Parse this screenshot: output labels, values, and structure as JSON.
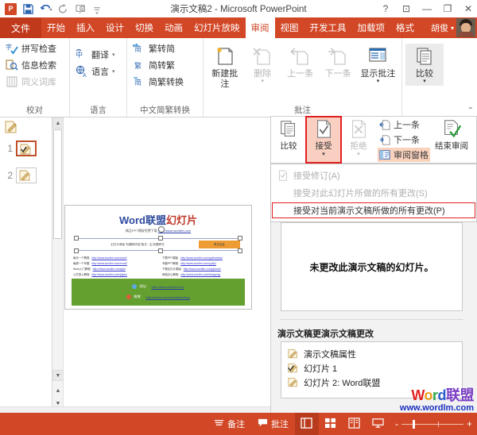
{
  "titlebar": {
    "app_logo": "powerpoint-logo",
    "title": "演示文稿2 - Microsoft PowerPoint",
    "quick_access": [
      {
        "name": "save-icon",
        "label": "保存"
      },
      {
        "name": "undo-icon",
        "label": "撤消"
      },
      {
        "name": "redo-icon",
        "label": "重复"
      },
      {
        "name": "from-beginning-icon",
        "label": "从头开始"
      },
      {
        "name": "customize-qat-icon",
        "label": "自定义快速访问工具栏"
      }
    ],
    "window_buttons": [
      {
        "name": "help-button",
        "glyph": "?"
      },
      {
        "name": "ribbon-display-options-button",
        "glyph": "⊡"
      },
      {
        "name": "minimize-button",
        "glyph": "—"
      },
      {
        "name": "maximize-button",
        "glyph": "❐"
      },
      {
        "name": "close-button",
        "glyph": "✕"
      }
    ]
  },
  "tabs": {
    "file_label": "文件",
    "items": [
      {
        "label": "开始",
        "active": false
      },
      {
        "label": "插入",
        "active": false
      },
      {
        "label": "设计",
        "active": false
      },
      {
        "label": "切换",
        "active": false
      },
      {
        "label": "动画",
        "active": false
      },
      {
        "label": "幻灯片放映",
        "active": false
      },
      {
        "label": "审阅",
        "active": true
      },
      {
        "label": "视图",
        "active": false
      },
      {
        "label": "开发工具",
        "active": false
      },
      {
        "label": "加载项",
        "active": false
      },
      {
        "label": "格式",
        "active": false
      }
    ],
    "user_name": "胡俊"
  },
  "ribbon": {
    "groups": [
      {
        "label": "校对",
        "buttons": [
          {
            "label": "拼写检查",
            "icon": "spellcheck-icon",
            "disabled": false
          },
          {
            "label": "信息检索",
            "icon": "research-icon",
            "disabled": false
          },
          {
            "label": "同义词库",
            "icon": "thesaurus-icon",
            "disabled": true
          }
        ]
      },
      {
        "label": "语言",
        "buttons": [
          {
            "label": "翻译",
            "icon": "translate-icon",
            "disabled": false,
            "caret": true
          },
          {
            "label": "语言",
            "icon": "language-icon",
            "disabled": false,
            "caret": true
          }
        ]
      },
      {
        "label": "中文简繁转换",
        "buttons": [
          {
            "label": "繁转简",
            "icon": "trad-to-simp-icon",
            "disabled": false
          },
          {
            "label": "简转繁",
            "icon": "simp-to-trad-icon",
            "disabled": false
          },
          {
            "label": "简繁转换",
            "icon": "simp-trad-convert-icon",
            "disabled": false
          }
        ]
      },
      {
        "label": "批注",
        "buttons": [
          {
            "label": "新建批注",
            "icon": "new-comment-icon",
            "disabled": false
          },
          {
            "label": "删除",
            "icon": "delete-comment-icon",
            "disabled": true,
            "caret": true
          },
          {
            "label": "上一条",
            "icon": "previous-comment-icon",
            "disabled": true
          },
          {
            "label": "下一条",
            "icon": "next-comment-icon",
            "disabled": true
          },
          {
            "label": "显示批注",
            "icon": "show-markup-icon",
            "disabled": false,
            "caret": true
          }
        ]
      },
      {
        "label": "",
        "buttons": [
          {
            "label": "比较",
            "icon": "compare-icon",
            "disabled": false,
            "caret": true,
            "selected": true
          }
        ]
      }
    ],
    "collapse_glyph": "⌃"
  },
  "compare_panel": {
    "buttons": [
      {
        "label": "比较",
        "icon": "compare-icon",
        "state": "normal",
        "caret": false
      },
      {
        "label": "接受",
        "icon": "accept-icon",
        "state": "highlight",
        "caret": true
      },
      {
        "label": "拒绝",
        "icon": "reject-icon",
        "state": "disabled",
        "caret": true
      }
    ],
    "middle_items": [
      {
        "label": "上一条",
        "icon": "previous-change-icon",
        "active": false
      },
      {
        "label": "下一条",
        "icon": "next-change-icon",
        "active": false
      },
      {
        "label": "审阅窗格",
        "icon": "reviewing-pane-icon",
        "active": true
      }
    ],
    "end_button": {
      "label": "结束审阅",
      "icon": "end-review-icon"
    }
  },
  "dropdown": {
    "items": [
      {
        "label": "接受修订(A)",
        "accesskey": "A",
        "icon": "accept-change-icon",
        "enabled": false,
        "boxed": false
      },
      {
        "label": "接受对此幻灯片所做的所有更改(S)",
        "accesskey": "S",
        "icon": "",
        "enabled": false,
        "boxed": false
      },
      {
        "label": "接受对当前演示文稿所做的所有更改(P)",
        "accesskey": "P",
        "icon": "",
        "enabled": true,
        "boxed": true
      }
    ]
  },
  "review_pane": {
    "card_message": "未更改此演示文稿的幻灯片。",
    "section_heading": "演示文稿更改",
    "section_heading_overlap": "演示文稿更",
    "items": [
      {
        "label": "演示文稿属性",
        "icon": "slide-edit-icon"
      },
      {
        "label": "幻灯片 1",
        "icon": "slide-checked-icon"
      },
      {
        "label": "幻灯片 2: Word联盟",
        "icon": "slide-edit-icon"
      }
    ]
  },
  "thumbnails": {
    "slides": [
      {
        "number": "1",
        "selected": true,
        "icon": "slide-checked-icon"
      },
      {
        "number": "2",
        "selected": false,
        "icon": "slide-edit-icon"
      }
    ]
  },
  "slide": {
    "title_blue": "Word联盟",
    "title_red": "幻灯片",
    "subtitle_text": "精品PPT模板免费下载",
    "subtitle_link": "http://www.wordlm.com",
    "shape_bar_text": "幻灯片母版   “标题和内容”版式：由   标题样式",
    "shape_bar_orange_text": "单击此处",
    "links_left": [
      {
        "label": "每天一个教程",
        "url": "http://www.wordlm.com/word/"
      },
      {
        "label": "每周一个专题",
        "url": "http://www.wordlm.com/excel/"
      },
      {
        "label": "Word入门教程",
        "url": "http://www.wordlm.com/ppt/"
      },
      {
        "label": "公式录入教程",
        "url": "http://www.wordlm.com/jiqiao/"
      },
      {
        "label": "排版一点通",
        "url": "http://www.wordlm.com/moban/"
      }
    ],
    "links_right": [
      {
        "label": "下载PPT模板",
        "url": "http://www.wordlm.com/ppt/moban/"
      },
      {
        "label": "专题PPT教程",
        "url": "http://www.wordlm.com/ppt/jc/"
      },
      {
        "label": "下载幻灯片模版",
        "url": "http://www.wordlm.com/ppt/mb/"
      },
      {
        "label": "网络办公教程",
        "url": "http://www.wordlm.com/bangong/"
      },
      {
        "label": "一键三连支持",
        "url": "http://www.wordlm.com/other/"
      }
    ],
    "footer_links": [
      {
        "icon": "globe-icon",
        "label": "网址：",
        "url": "http://www.wordlm.com"
      },
      {
        "icon": "eye-icon",
        "label": "微博：",
        "url": "http://weibo.com/wordlianmeng"
      }
    ]
  },
  "statusbar": {
    "notes_label": "备注",
    "comments_label": "批注",
    "notes_icon": "notes-icon",
    "comments_icon": "comments-icon",
    "views": [
      {
        "name": "normal-view-button",
        "icon": "normal-view-icon",
        "active": true
      },
      {
        "name": "slide-sorter-button",
        "icon": "slide-sorter-icon",
        "active": false
      },
      {
        "name": "reading-view-button",
        "icon": "reading-view-icon",
        "active": false
      },
      {
        "name": "slideshow-button",
        "icon": "slideshow-icon",
        "active": false
      }
    ],
    "zoom_minus": "-",
    "zoom_plus": "+"
  },
  "watermark": {
    "line1_parts": [
      "W",
      "o",
      "r",
      "d",
      "联盟"
    ],
    "line2": "www.wordlm.com"
  },
  "colors": {
    "accent": "#d24726",
    "file_tab": "#c0391b",
    "highlight_box": "#e02020",
    "highlight_fill": "#f8cfc0",
    "slide_green": "#63a030"
  }
}
